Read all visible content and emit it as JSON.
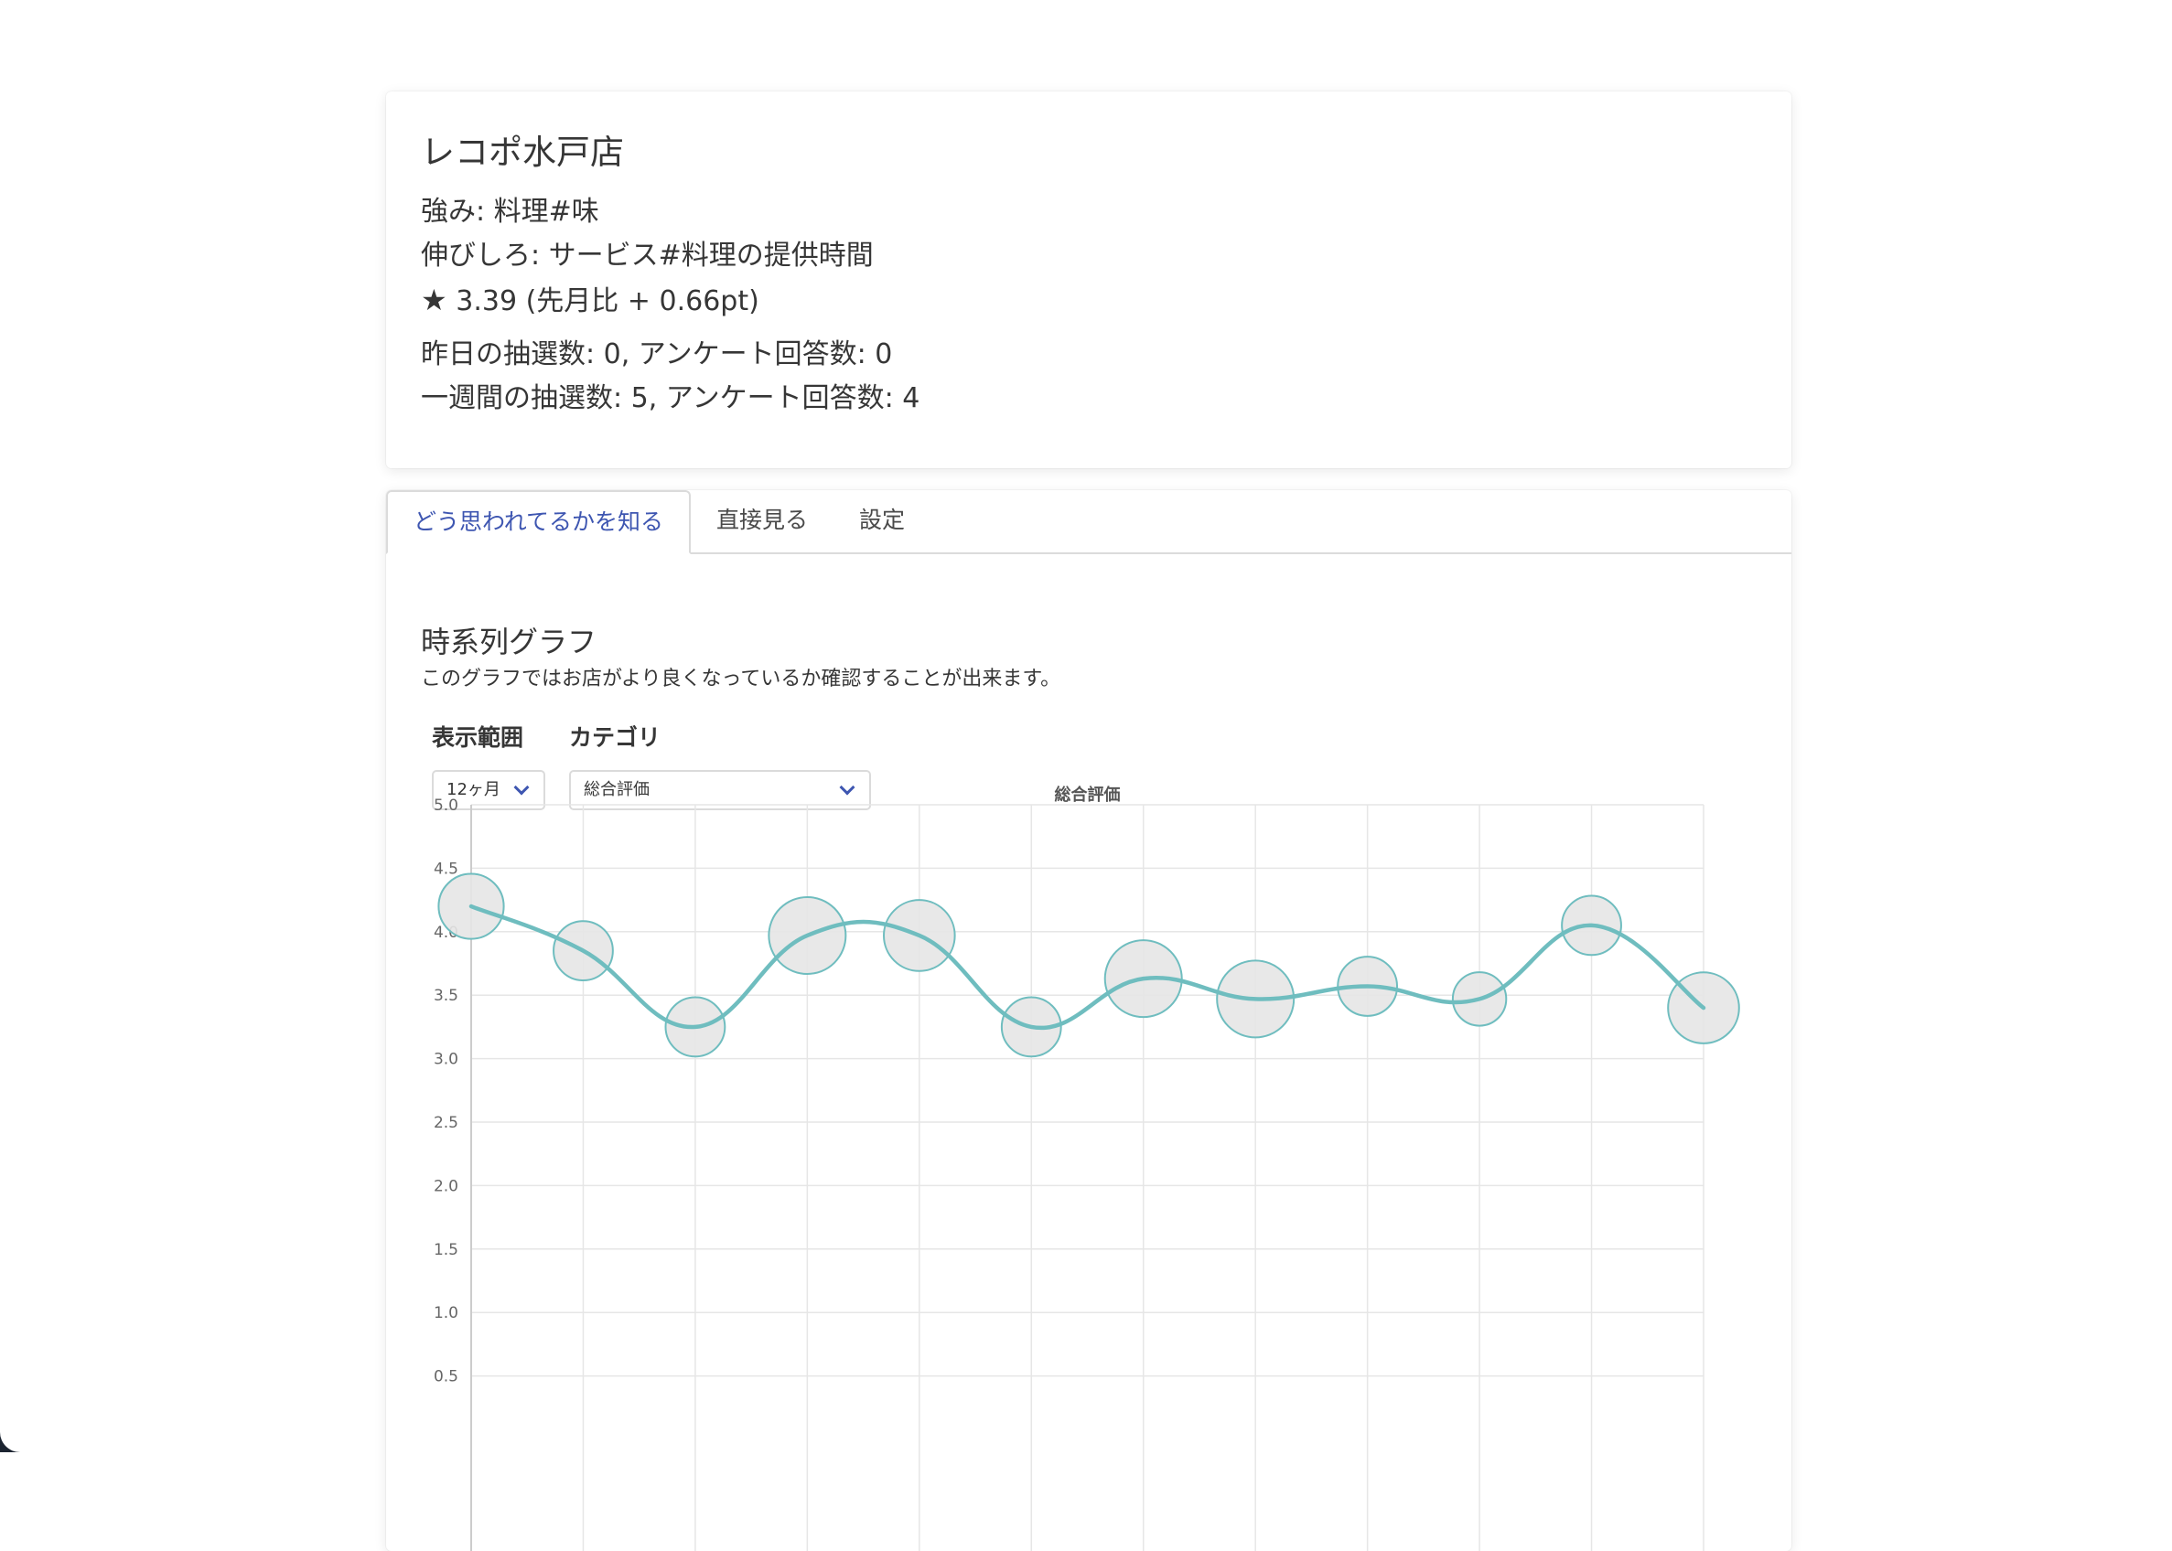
{
  "store": {
    "name": "レコポ水戸店",
    "strength": "強み: 料理#味",
    "growth": "伸びしろ: サービス#料理の提供時間",
    "rating_star": "★",
    "rating": "3.39 (先月比 + 0.66pt)",
    "yesterday": "昨日の抽選数: 0, アンケート回答数: 0",
    "week": "一週間の抽選数: 5, アンケート回答数: 4"
  },
  "tabs": [
    {
      "label": "どう思われてるかを知る",
      "active": true
    },
    {
      "label": "直接見る",
      "active": false
    },
    {
      "label": "設定",
      "active": false
    }
  ],
  "section": {
    "title": "時系列グラフ",
    "description": "このグラフではお店がより良くなっているか確認することが出来ます。"
  },
  "filters": {
    "range_label": "表示範囲",
    "range_value": "12ヶ月",
    "category_label": "カテゴリ",
    "category_value": "総合評価"
  },
  "colors": {
    "line": "#6fbdbf",
    "bubble_fill": "#e6e6e6",
    "bubble_stroke": "#6fbdbf",
    "grid": "#e6e6e6",
    "accent": "#3e56b1"
  },
  "chart_data": {
    "type": "line",
    "title": "総合評価",
    "ylim": [
      0,
      5
    ],
    "yticks": [
      "5.0",
      "4.5",
      "4.0",
      "3.5",
      "3.0",
      "2.5",
      "2.0",
      "1.5",
      "1.0",
      "0.5"
    ],
    "grid": true,
    "series": [
      {
        "values": [
          4.2,
          3.85,
          3.25,
          3.97,
          3.97,
          3.25,
          3.63,
          3.47,
          3.57,
          3.47,
          4.05,
          3.4
        ],
        "bubble_size": [
          3,
          2,
          2,
          5,
          4,
          2,
          5,
          5,
          2,
          1,
          2,
          4
        ]
      }
    ]
  }
}
